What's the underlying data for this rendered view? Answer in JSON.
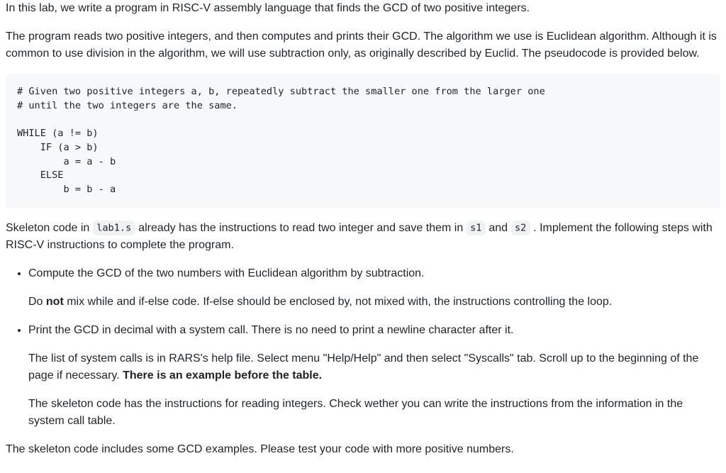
{
  "intro": {
    "p1": "In this lab, we write a program in RISC-V assembly language that finds the GCD of two positive integers.",
    "p2": "The program reads two positive integers, and then computes and prints their GCD. The algorithm we use is Euclidean algorithm. Although it is common to use division in the algorithm, we will use subtraction only, as originally described by Euclid. The pseudocode is provided below."
  },
  "pseudocode": "# Given two positive integers a, b, repeatedly subtract the smaller one from the larger one \n# until the two integers are the same.\n\nWHILE (a != b) \n    IF (a > b)\n        a = a - b\n    ELSE\n        b = b - a",
  "skeleton": {
    "prefix": "Skeleton code in ",
    "file": "lab1.s",
    "mid1": " already has the instructions to read two integer and save them in ",
    "reg1": "s1",
    "mid2": " and ",
    "reg2": "s2",
    "suffix": " . Implement the following steps with RISC-V instructions to complete the program."
  },
  "steps": {
    "item1": {
      "p1": "Compute the GCD of the two numbers with Euclidean algorithm by subtraction.",
      "p2_prefix": "Do ",
      "p2_bold": "not",
      "p2_suffix": " mix while and if-else code. If-else should be enclosed by, not mixed with, the instructions controlling the loop."
    },
    "item2": {
      "p1": "Print the GCD in decimal with a system call. There is no need to print a newline character after it.",
      "p2_prefix": "The list of system calls is in RARS's help file. Select menu \"Help/Help\" and then select \"Syscalls\" tab. Scroll up to the beginning of the page if necessary. ",
      "p2_bold": "There is an example before the table.",
      "p3": "The skeleton code has the instructions for reading integers. Check wether you can write the instructions from the information in the system call table."
    }
  },
  "closing": "The skeleton code includes some GCD examples. Please test your code with more positive numbers."
}
